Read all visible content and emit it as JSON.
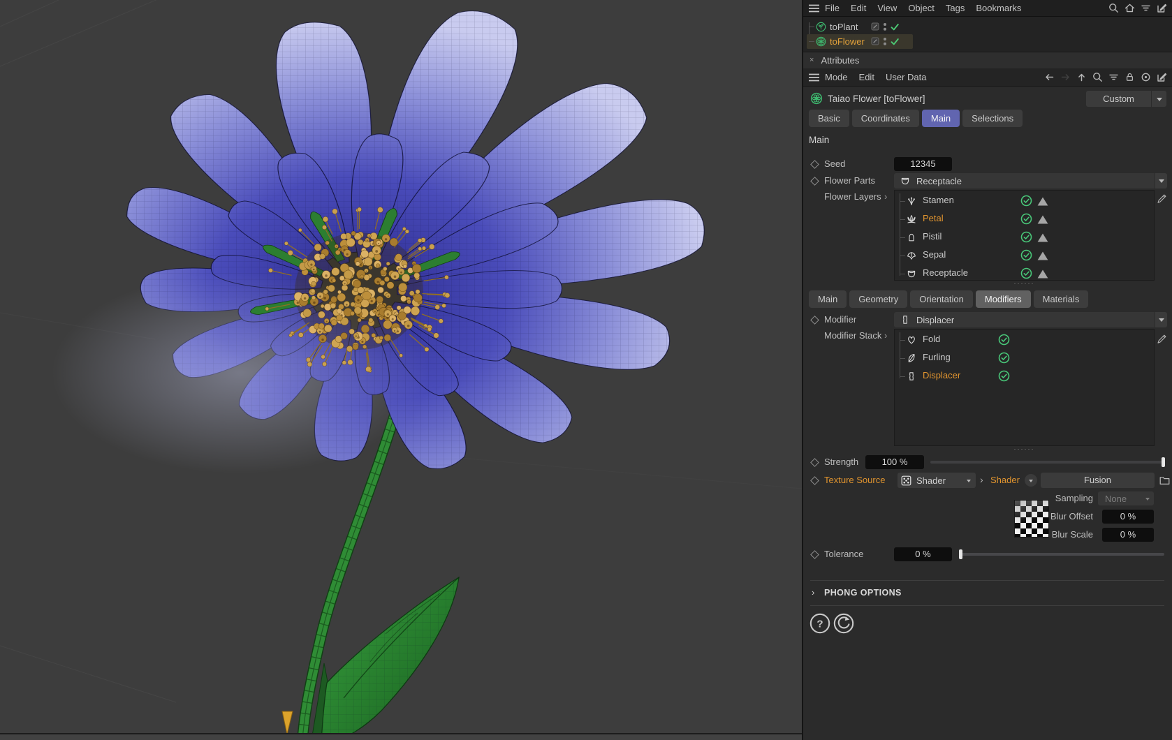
{
  "colors": {
    "viewport_bg": "#3d3d3d",
    "tab_accent": "#6165b0",
    "selection_orange": "#e2952f",
    "check_green": "#49c879",
    "slider_purple": "#6e73cb"
  },
  "top_menu": {
    "items": [
      "File",
      "Edit",
      "View",
      "Object",
      "Tags",
      "Bookmarks"
    ],
    "right_icons": [
      "search-icon",
      "home-icon",
      "filter-icon",
      "compose-window-icon"
    ]
  },
  "objects": [
    {
      "name": "toPlant",
      "icon": "plant-icon",
      "selected": false
    },
    {
      "name": "toFlower",
      "icon": "flower-icon",
      "selected": true
    }
  ],
  "attributes": {
    "panel_title": "Attributes",
    "menu_items": [
      "Mode",
      "Edit",
      "User Data"
    ],
    "nav_icons": [
      {
        "icon": "back-arrow-icon",
        "enabled": true
      },
      {
        "icon": "forward-arrow-icon",
        "enabled": false
      },
      {
        "icon": "up-arrow-icon",
        "enabled": true
      },
      {
        "icon": "search-icon",
        "enabled": true
      },
      {
        "icon": "filter-icon",
        "enabled": true
      },
      {
        "icon": "lock-icon",
        "enabled": true
      },
      {
        "icon": "target-icon",
        "enabled": true
      },
      {
        "icon": "compose-window-icon",
        "enabled": true
      }
    ],
    "object_icon": "flower-icon",
    "object_title": "Taiao Flower [toFlower]",
    "preset": "Custom",
    "tabs": [
      "Basic",
      "Coordinates",
      "Main",
      "Selections"
    ],
    "active_tab": "Main",
    "section_title": "Main",
    "seed": {
      "label": "Seed",
      "value": "12345"
    },
    "flower_parts": {
      "label": "Flower Parts",
      "value": "Receptacle",
      "icon": "receptacle-icon"
    },
    "flower_layers": {
      "label": "Flower Layers",
      "items": [
        {
          "name": "Stamen",
          "icon": "stamen-icon",
          "enabled": true,
          "selected": false
        },
        {
          "name": "Petal",
          "icon": "petal-icon",
          "enabled": true,
          "selected": true
        },
        {
          "name": "Pistil",
          "icon": "pistil-icon",
          "enabled": true,
          "selected": false
        },
        {
          "name": "Sepal",
          "icon": "sepal-icon",
          "enabled": true,
          "selected": false
        },
        {
          "name": "Receptacle",
          "icon": "receptacle-icon",
          "enabled": true,
          "selected": false
        }
      ]
    },
    "sub_tabs": [
      "Main",
      "Geometry",
      "Orientation",
      "Modifiers",
      "Materials"
    ],
    "active_sub_tab": "Modifiers",
    "modifier": {
      "label": "Modifier",
      "value": "Displacer",
      "icon": "displacer-icon"
    },
    "modifier_stack": {
      "label": "Modifier Stack",
      "items": [
        {
          "name": "Fold",
          "icon": "fold-icon",
          "enabled": true,
          "selected": false
        },
        {
          "name": "Furling",
          "icon": "furling-icon",
          "enabled": true,
          "selected": false
        },
        {
          "name": "Displacer",
          "icon": "displacer-icon",
          "enabled": true,
          "selected": true
        }
      ]
    },
    "strength": {
      "label": "Strength",
      "value": "100 %",
      "percent": 100
    },
    "texture_source": {
      "label": "Texture Source",
      "shader_kind": "Shader",
      "shader_link": "Shader",
      "button": "Fusion"
    },
    "sampling": {
      "label": "Sampling",
      "value": "None",
      "enabled": false
    },
    "blur_offset": {
      "label": "Blur Offset",
      "value": "0 %"
    },
    "blur_scale": {
      "label": "Blur Scale",
      "value": "0 %"
    },
    "tolerance": {
      "label": "Tolerance",
      "value": "0 %",
      "percent": 0
    },
    "phong_section": "PHONG OPTIONS",
    "footer_icons": [
      "help-icon",
      "reset-icon"
    ]
  },
  "viewport": {
    "content": "wireframe flower model",
    "petal_color_dark": "#34349b",
    "petal_color_light": "#c9cbef",
    "stamen_gold": "#caa04e",
    "stem_green": "#2f8c35",
    "marker_orange": "#dca32b"
  }
}
